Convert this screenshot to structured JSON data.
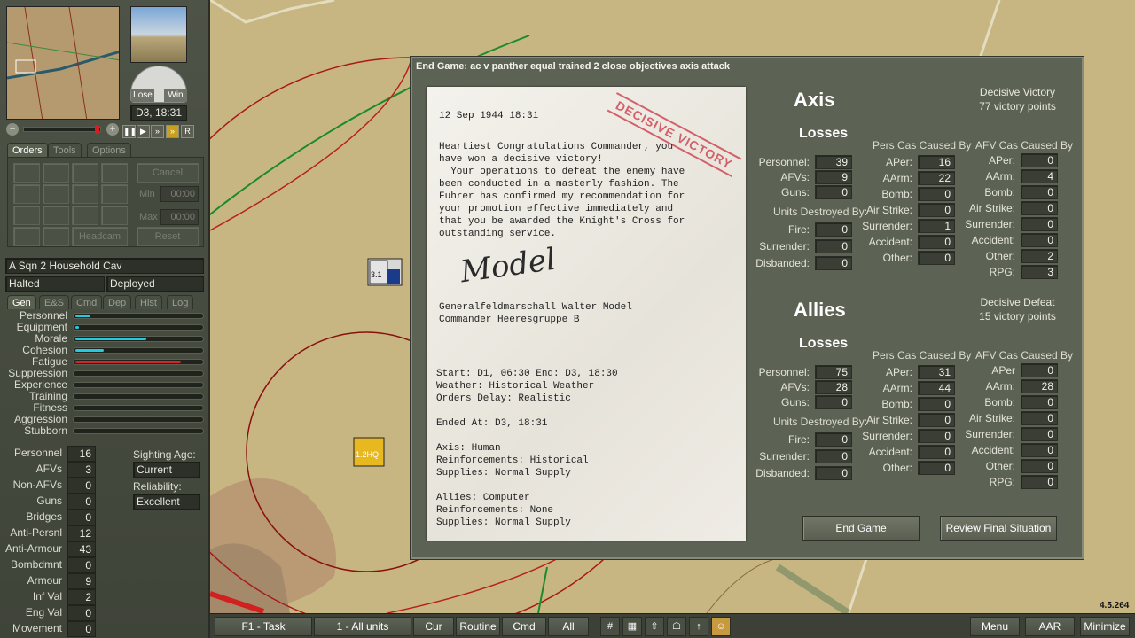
{
  "left_panel": {
    "date_time": "D3, 18:31",
    "lose_label": "Lose",
    "win_label": "Win",
    "panel_tabs": [
      "Orders",
      "Tools",
      "Options"
    ],
    "order_buttons": {
      "cancel": "Cancel",
      "min": "Min",
      "max": "Max",
      "min_value": "00:00",
      "max_value": "00:00",
      "headcam": "Headcam",
      "reset": "Reset"
    },
    "replay": {
      "r": "R"
    },
    "unit_name": "A Sqn 2 Household Cav",
    "unit_status": "Halted",
    "unit_mode": "Deployed",
    "detail_tabs": [
      "Gen",
      "E&S",
      "Cmd",
      "Dep",
      "Hist",
      "Log"
    ],
    "bars": [
      {
        "label": "Personnel",
        "fill": 0.12,
        "color": "#27c9e0"
      },
      {
        "label": "Equipment",
        "fill": 0.03,
        "color": "#27c9e0"
      },
      {
        "label": "Morale",
        "fill": 0.57,
        "color": "#27c9e0"
      },
      {
        "label": "Cohesion",
        "fill": 0.23,
        "color": "#27c9e0"
      },
      {
        "label": "Fatigue",
        "fill": 0.85,
        "color": "#d0282a"
      },
      {
        "label": "Suppression",
        "fill": 0,
        "color": "#27c9e0"
      },
      {
        "label": "Experience",
        "fill": 0,
        "color": "#27c9e0"
      },
      {
        "label": "Training",
        "fill": 0,
        "color": "#27c9e0"
      },
      {
        "label": "Fitness",
        "fill": 0,
        "color": "#27c9e0"
      },
      {
        "label": "Aggression",
        "fill": 0,
        "color": "#27c9e0"
      },
      {
        "label": "Stubborn",
        "fill": 0,
        "color": "#27c9e0"
      }
    ],
    "stats": [
      {
        "label": "Personnel",
        "value": "16"
      },
      {
        "label": "AFVs",
        "value": "3"
      },
      {
        "label": "Non-AFVs",
        "value": "0"
      },
      {
        "label": "Guns",
        "value": "0"
      },
      {
        "label": "Bridges",
        "value": "0"
      },
      {
        "label": "Anti-Persnl",
        "value": "12"
      },
      {
        "label": "Anti-Armour",
        "value": "43"
      },
      {
        "label": "Bombdmnt",
        "value": "0"
      },
      {
        "label": "Armour",
        "value": "9"
      },
      {
        "label": "Inf Val",
        "value": "2"
      },
      {
        "label": "Eng Val",
        "value": "0"
      },
      {
        "label": "Movement",
        "value": "0"
      }
    ],
    "sighting_age_label": "Sighting Age:",
    "sighting_age_value": "Current",
    "reliability_label": "Reliability:",
    "reliability_value": "Excellent"
  },
  "map": {
    "unit1_label": "3.1",
    "unit2_label": "1.2HQ"
  },
  "dialog": {
    "title": "End Game: ac  v panther equal trained 2 close objectives axis attack",
    "letter": {
      "date": "12 Sep 1944 18:31",
      "stamp": "DECISIVE VICTORY",
      "body": [
        "Heartiest Congratulations Commander, you",
        "have won a decisive victory!",
        "  Your operations to defeat the enemy have",
        "been conducted in a masterly fashion. The",
        "Fuhrer has confirmed my recommendation for",
        "your promotion effective immediately and",
        "that you be awarded the Knight's Cross for",
        "outstanding service."
      ],
      "signature": "Model",
      "sig_lines": [
        "Generalfeldmarschall Walter Model",
        "Commander Heeresgruppe B"
      ],
      "info": [
        "Start: D1, 06:30 End: D3, 18:30",
        "Weather: Historical Weather",
        "Orders Delay: Realistic",
        "",
        "Ended At: D3, 18:31",
        "",
        "Axis: Human",
        "Reinforcements: Historical",
        "Supplies: Normal Supply",
        "",
        "Allies: Computer",
        "Reinforcements: None",
        "Supplies: Normal Supply"
      ]
    },
    "sides": [
      {
        "name": "Axis",
        "result": "Decisive Victory",
        "points": "77 victory points",
        "losses_label": "Losses",
        "losses": [
          {
            "label": "Personnel:",
            "value": "39"
          },
          {
            "label": "AFVs:",
            "value": "9"
          },
          {
            "label": "Guns:",
            "value": "0"
          }
        ],
        "units_destroyed_label": "Units Destroyed By:",
        "destroyed": [
          {
            "label": "Fire:",
            "value": "0"
          },
          {
            "label": "Surrender:",
            "value": "0"
          },
          {
            "label": "Disbanded:",
            "value": "0"
          }
        ],
        "pers_caption": "Pers Cas Caused By",
        "pers": [
          {
            "label": "APer:",
            "value": "16"
          },
          {
            "label": "AArm:",
            "value": "22"
          },
          {
            "label": "Bomb:",
            "value": "0"
          },
          {
            "label": "Air Strike:",
            "value": "0"
          },
          {
            "label": "Surrender:",
            "value": "1"
          },
          {
            "label": "Accident:",
            "value": "0"
          },
          {
            "label": "Other:",
            "value": "0"
          }
        ],
        "afv_caption": "AFV Cas Caused By",
        "afv": [
          {
            "label": "APer:",
            "value": "0"
          },
          {
            "label": "AArm:",
            "value": "4"
          },
          {
            "label": "Bomb:",
            "value": "0"
          },
          {
            "label": "Air Strike:",
            "value": "0"
          },
          {
            "label": "Surrender:",
            "value": "0"
          },
          {
            "label": "Accident:",
            "value": "0"
          },
          {
            "label": "Other:",
            "value": "2"
          },
          {
            "label": "RPG:",
            "value": "3"
          }
        ]
      },
      {
        "name": "Allies",
        "result": "Decisive Defeat",
        "points": "15 victory points",
        "losses_label": "Losses",
        "losses": [
          {
            "label": "Personnel:",
            "value": "75"
          },
          {
            "label": "AFVs:",
            "value": "28"
          },
          {
            "label": "Guns:",
            "value": "0"
          }
        ],
        "units_destroyed_label": "Units Destroyed By:",
        "destroyed": [
          {
            "label": "Fire:",
            "value": "0"
          },
          {
            "label": "Surrender:",
            "value": "0"
          },
          {
            "label": "Disbanded:",
            "value": "0"
          }
        ],
        "pers_caption": "Pers Cas Caused By",
        "pers": [
          {
            "label": "APer:",
            "value": "31"
          },
          {
            "label": "AArm:",
            "value": "44"
          },
          {
            "label": "Bomb:",
            "value": "0"
          },
          {
            "label": "Air Strike:",
            "value": "0"
          },
          {
            "label": "Surrender:",
            "value": "0"
          },
          {
            "label": "Accident:",
            "value": "0"
          },
          {
            "label": "Other:",
            "value": "0"
          }
        ],
        "afv_caption": "AFV Cas Caused By",
        "afv": [
          {
            "label": "APer",
            "value": "0"
          },
          {
            "label": "AArm:",
            "value": "28"
          },
          {
            "label": "Bomb:",
            "value": "0"
          },
          {
            "label": "Air Strike:",
            "value": "0"
          },
          {
            "label": "Surrender:",
            "value": "0"
          },
          {
            "label": "Accident:",
            "value": "0"
          },
          {
            "label": "Other:",
            "value": "0"
          },
          {
            "label": "RPG:",
            "value": "0"
          }
        ]
      }
    ],
    "end_game_button": "End Game",
    "review_button": "Review Final Situation"
  },
  "bottom_bar": {
    "task": "F1 - Task",
    "units": "1 - All units",
    "cur": "Cur",
    "routine": "Routine",
    "cmd": "Cmd",
    "all": "All",
    "menu": "Menu",
    "aar": "AAR",
    "minimize": "Minimize"
  },
  "version": "4.5.264"
}
